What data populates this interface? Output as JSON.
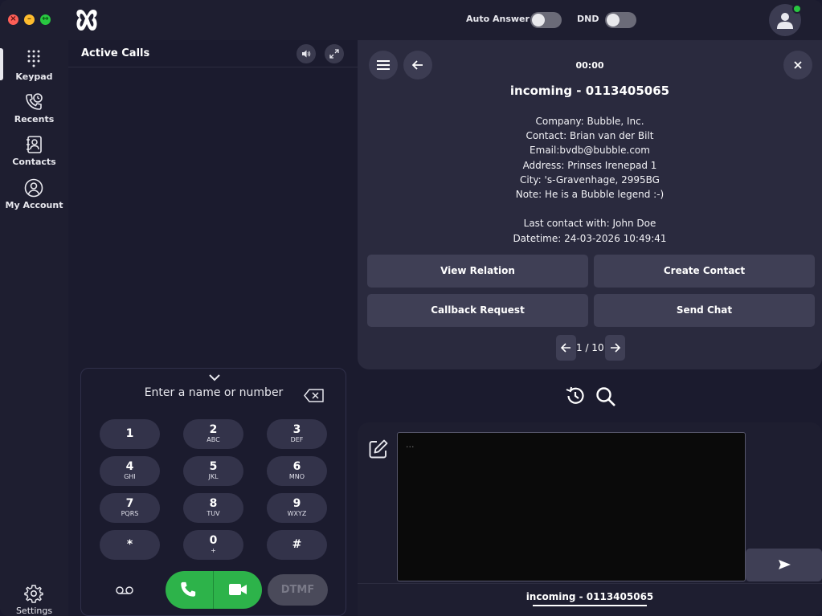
{
  "header": {
    "auto_answer_label": "Auto Answer",
    "dnd_label": "DND"
  },
  "nav": {
    "items": [
      {
        "label": "Keypad",
        "icon": "keypad-icon"
      },
      {
        "label": "Recents",
        "icon": "recents-icon"
      },
      {
        "label": "Contacts",
        "icon": "contacts-icon"
      },
      {
        "label": "My Account",
        "icon": "account-icon"
      }
    ],
    "settings_label": "Settings"
  },
  "active_calls": {
    "title": "Active Calls"
  },
  "dialpad": {
    "input_placeholder": "Enter a name or number",
    "keys": [
      {
        "digit": "1",
        "letters": ""
      },
      {
        "digit": "2",
        "letters": "ABC"
      },
      {
        "digit": "3",
        "letters": "DEF"
      },
      {
        "digit": "4",
        "letters": "GHI"
      },
      {
        "digit": "5",
        "letters": "JKL"
      },
      {
        "digit": "6",
        "letters": "MNO"
      },
      {
        "digit": "7",
        "letters": "PQRS"
      },
      {
        "digit": "8",
        "letters": "TUV"
      },
      {
        "digit": "9",
        "letters": "WXYZ"
      },
      {
        "digit": "*",
        "letters": ""
      },
      {
        "digit": "0",
        "letters": "+"
      },
      {
        "digit": "#",
        "letters": ""
      }
    ],
    "dtmf_label": "DTMF"
  },
  "call": {
    "timer": "00:00",
    "title": "incoming - 0113405065",
    "info_lines": [
      "Company: Bubble, Inc.",
      "Contact: Brian van der Bilt",
      "Email:bvdb@bubble.com",
      "Address: Prinses Irenepad 1",
      "City: 's-Gravenhage, 2995BG",
      "Note: He is a Bubble legend :-)",
      "",
      "Last contact with: John Doe",
      "Datetime: 24-03-2026 10:49:41"
    ],
    "actions": {
      "view_relation": "View Relation",
      "create_contact": "Create Contact",
      "callback_request": "Callback Request",
      "send_chat": "Send Chat"
    },
    "pager": "1 / 10"
  },
  "notes": {
    "placeholder": "..."
  },
  "bottom_tab": {
    "label": "incoming - 0113405065"
  },
  "colors": {
    "call_green": "#2db34a",
    "status_online": "#28c840",
    "background": "#1b1b2e",
    "card": "#2a2a3e"
  }
}
